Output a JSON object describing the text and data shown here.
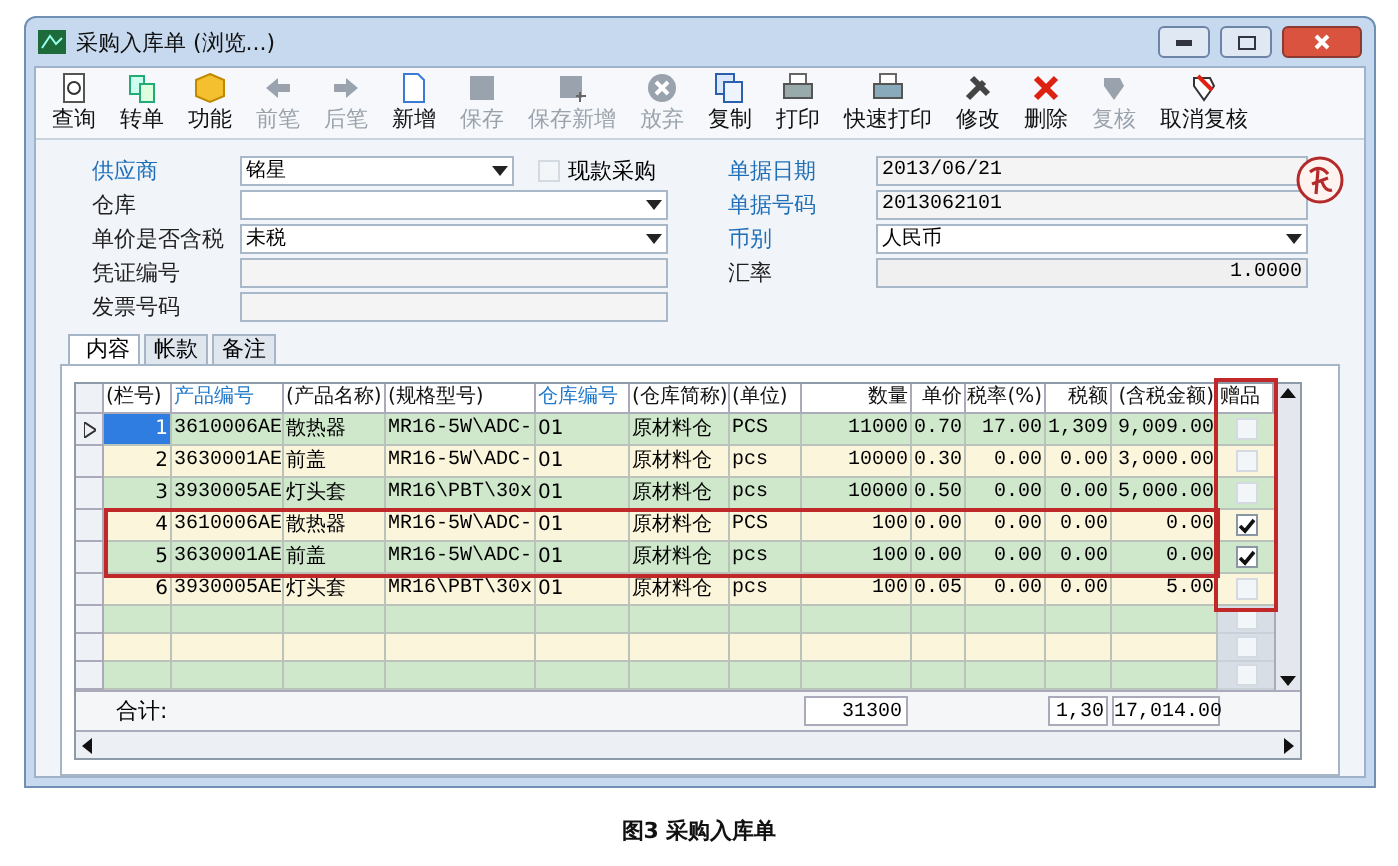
{
  "window": {
    "title": "采购入库单 (浏览...)"
  },
  "toolbar": [
    {
      "label": "查询",
      "disabled": false
    },
    {
      "label": "转单",
      "disabled": false
    },
    {
      "label": "功能",
      "disabled": false
    },
    {
      "label": "前笔",
      "disabled": true
    },
    {
      "label": "后笔",
      "disabled": true
    },
    {
      "label": "新增",
      "disabled": false
    },
    {
      "label": "保存",
      "disabled": true
    },
    {
      "label": "保存新增",
      "disabled": true
    },
    {
      "label": "放弃",
      "disabled": true
    },
    {
      "label": "复制",
      "disabled": false
    },
    {
      "label": "打印",
      "disabled": false
    },
    {
      "label": "快速打印",
      "disabled": false
    },
    {
      "label": "修改",
      "disabled": false
    },
    {
      "label": "删除",
      "disabled": false
    },
    {
      "label": "复核",
      "disabled": true
    },
    {
      "label": "取消复核",
      "disabled": false
    }
  ],
  "form_left": [
    {
      "label": "供应商",
      "highlighted": true,
      "kind": "dropdown",
      "value": "铭星",
      "checkbox": {
        "label": "现款采购",
        "checked": false
      }
    },
    {
      "label": "仓库",
      "highlighted": false,
      "kind": "dropdown"
    },
    {
      "label": "单价是否含税",
      "highlighted": false,
      "kind": "dropdown",
      "value": "未税"
    },
    {
      "label": "凭证编号",
      "highlighted": false,
      "kind": "text"
    },
    {
      "label": "发票号码",
      "highlighted": false,
      "kind": "text"
    }
  ],
  "form_right": [
    {
      "label": "单据日期",
      "highlighted": true,
      "kind": "date",
      "value": "2013/06/21"
    },
    {
      "label": "单据号码",
      "highlighted": true,
      "kind": "text",
      "value": "2013062101"
    },
    {
      "label": "币别",
      "highlighted": true,
      "kind": "dropdown",
      "value": "人民币"
    },
    {
      "label": "汇率",
      "highlighted": false,
      "kind": "number",
      "value": "1.0000"
    }
  ],
  "tabs": [
    {
      "label": "内容",
      "selected": true
    },
    {
      "label": "帐款",
      "selected": false
    },
    {
      "label": "备注",
      "selected": false
    }
  ],
  "table": {
    "columns": [
      {
        "label": "(栏号)",
        "linked": false
      },
      {
        "label": "产品编号",
        "linked": true
      },
      {
        "label": "(产品名称)",
        "linked": false
      },
      {
        "label": "(规格型号)",
        "linked": false
      },
      {
        "label": "仓库编号",
        "linked": true
      },
      {
        "label": "(仓库简称)",
        "linked": false
      },
      {
        "label": "(单位)",
        "linked": false
      },
      {
        "label": "数量",
        "linked": false
      },
      {
        "label": "单价",
        "linked": false
      },
      {
        "label": "税率(%)",
        "linked": false
      },
      {
        "label": "税额",
        "linked": false
      },
      {
        "label": "(含税金额)",
        "linked": false
      },
      {
        "label": "赠品",
        "linked": false
      }
    ],
    "rows": [
      {
        "selected": true,
        "cells": [
          "1",
          "3610006AE",
          "散热器",
          "MR16-5W\\ADC-",
          "01",
          "原材料仓",
          "PCS",
          "11000",
          "0.70",
          "17.00",
          "1,309",
          "9,009.00"
        ],
        "gift": false
      },
      {
        "selected": false,
        "cells": [
          "2",
          "3630001AE",
          "前盖",
          "MR16-5W\\ADC-",
          "01",
          "原材料仓",
          "pcs",
          "10000",
          "0.30",
          "0.00",
          "0.00",
          "3,000.00"
        ],
        "gift": false
      },
      {
        "selected": false,
        "cells": [
          "3",
          "3930005AE",
          "灯头套",
          "MR16\\PBT\\30x",
          "01",
          "原材料仓",
          "pcs",
          "10000",
          "0.50",
          "0.00",
          "0.00",
          "5,000.00"
        ],
        "gift": false
      },
      {
        "selected": false,
        "cells": [
          "4",
          "3610006AE",
          "散热器",
          "MR16-5W\\ADC-",
          "01",
          "原材料仓",
          "PCS",
          "100",
          "0.00",
          "0.00",
          "0.00",
          "0.00"
        ],
        "gift": true
      },
      {
        "selected": false,
        "cells": [
          "5",
          "3630001AE",
          "前盖",
          "MR16-5W\\ADC-",
          "01",
          "原材料仓",
          "pcs",
          "100",
          "0.00",
          "0.00",
          "0.00",
          "0.00"
        ],
        "gift": true
      },
      {
        "selected": false,
        "cells": [
          "6",
          "3930005AE",
          "灯头套",
          "MR16\\PBT\\30x",
          "01",
          "原材料仓",
          "pcs",
          "100",
          "0.05",
          "0.00",
          "0.00",
          "5.00"
        ],
        "gift": false
      }
    ],
    "blank_rows": [
      {
        "gift": false
      },
      {
        "gift": false
      },
      {
        "gift": false
      }
    ],
    "totals": {
      "label": "合计:",
      "quantity": "31300",
      "tax": "1,30",
      "amount": "17,014.00"
    }
  },
  "caption": "图3 采购入库单"
}
